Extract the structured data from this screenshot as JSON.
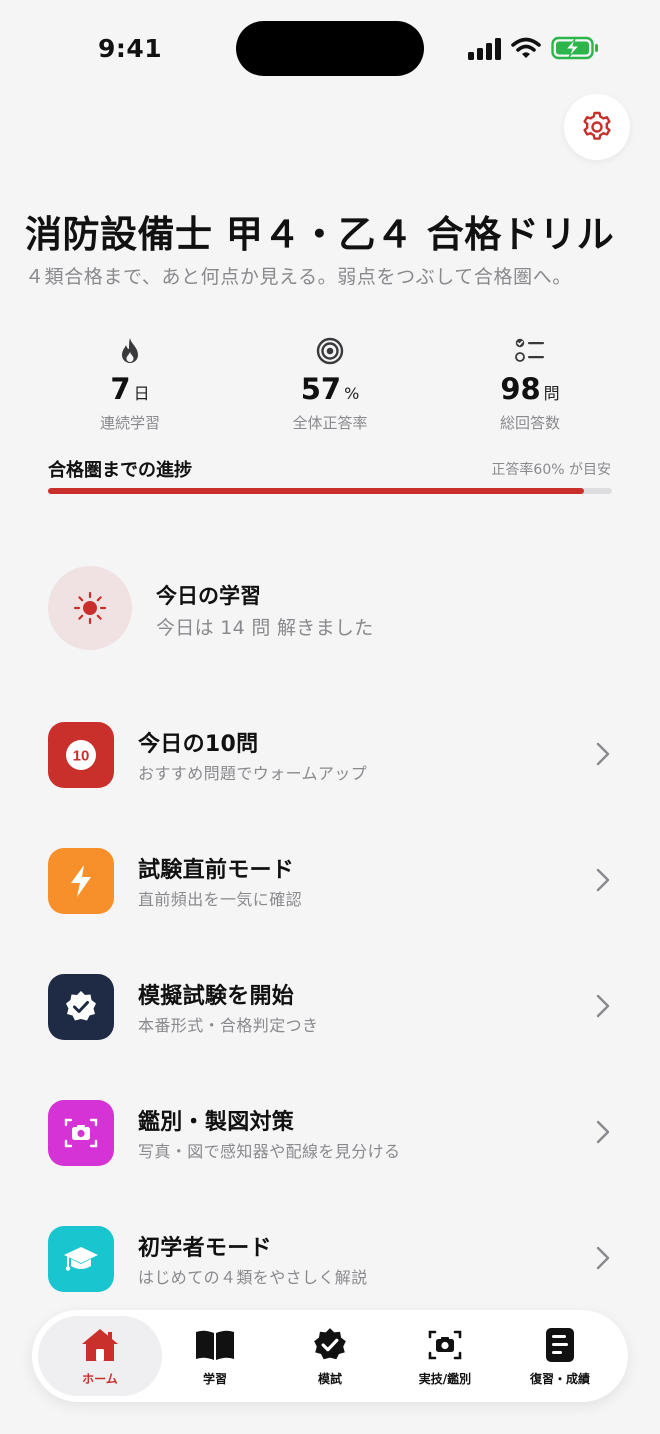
{
  "status_bar": {
    "time": "9:41"
  },
  "header": {
    "title": "消防設備士 甲４・乙４ 合格ドリル",
    "subtitle": "４類合格まで、あと何点か見える。弱点をつぶして合格圏へ。"
  },
  "stats": [
    {
      "icon": "flame-icon",
      "value": "7",
      "unit": "日",
      "label": "連続学習"
    },
    {
      "icon": "target-icon",
      "value": "57",
      "unit": "%",
      "label": "全体正答率"
    },
    {
      "icon": "checklist-icon",
      "value": "98",
      "unit": "問",
      "label": "総回答数"
    }
  ],
  "progress": {
    "title": "合格圏までの進捗",
    "note": "正答率60% が目安",
    "value_fraction": 0.95,
    "color": "#c9302c"
  },
  "today": {
    "icon": "sun-icon",
    "title": "今日の学習",
    "subtitle": "今日は 14 問 解きました"
  },
  "menu": [
    {
      "icon": "ten-badge-icon",
      "color": "#c9302c",
      "title": "今日の10問",
      "subtitle": "おすすめ問題でウォームアップ"
    },
    {
      "icon": "lightning-icon",
      "color": "#f7902a",
      "title": "試験直前モード",
      "subtitle": "直前頻出を一気に確認"
    },
    {
      "icon": "verified-badge-icon",
      "color": "#1f2a44",
      "title": "模擬試験を開始",
      "subtitle": "本番形式・合格判定つき"
    },
    {
      "icon": "camera-scan-icon",
      "color": "#d633d6",
      "title": "鑑別・製図対策",
      "subtitle": "写真・図で感知器や配線を見分ける"
    },
    {
      "icon": "graduation-cap-icon",
      "color": "#19c6cf",
      "title": "初学者モード",
      "subtitle": "はじめての４類をやさしく解説"
    }
  ],
  "tabs": [
    {
      "icon": "home-icon",
      "label": "ホーム",
      "active": true
    },
    {
      "icon": "book-icon",
      "label": "学習"
    },
    {
      "icon": "verified-badge-icon",
      "label": "模試"
    },
    {
      "icon": "camera-scan-icon",
      "label": "実技/鑑別"
    },
    {
      "icon": "report-icon",
      "label": "復習・成績"
    }
  ]
}
